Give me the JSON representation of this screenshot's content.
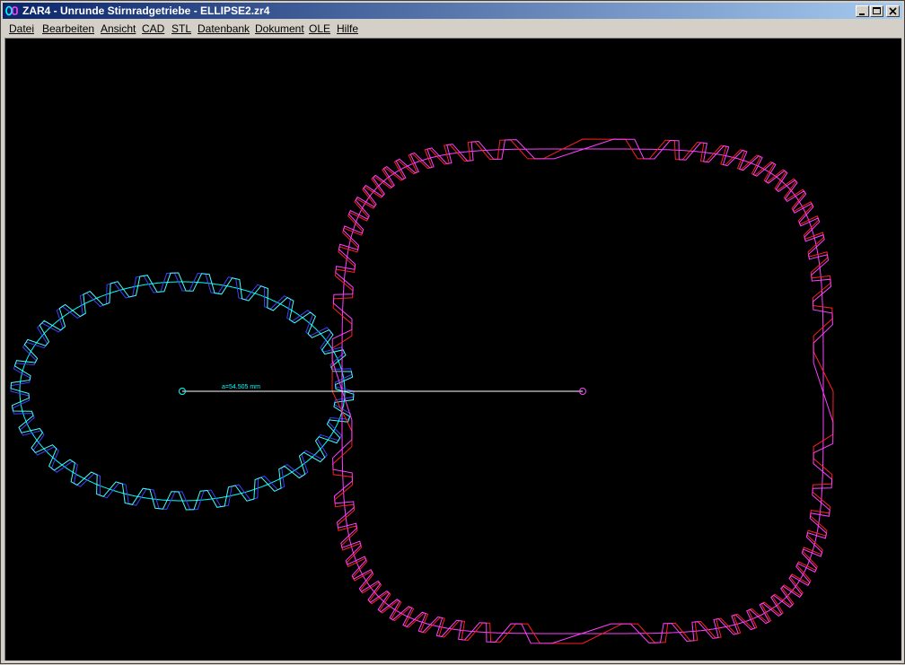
{
  "window": {
    "title": "ZAR4 - Unrunde Stirnradgetriebe  -  ELLIPSE2.zr4",
    "icon": "zar4-app-icon"
  },
  "menu": {
    "items": [
      {
        "label": "Datei"
      },
      {
        "label": "Bearbeiten"
      },
      {
        "label": "Ansicht"
      },
      {
        "label": "CAD"
      },
      {
        "label": "STL"
      },
      {
        "label": "Datenbank"
      },
      {
        "label": "Dokument"
      },
      {
        "label": "OLE"
      },
      {
        "label": "Hilfe"
      }
    ]
  },
  "drawing": {
    "distance_label": "a=54.505 mm",
    "colors": {
      "background": "#000000",
      "gear1_pitch": "#00ffff",
      "gear1_flank_a": "#4040ff",
      "gear1_flank_b": "#40ffff",
      "gear2_pitch": "#ff40ff",
      "gear2_flank_a": "#ff2020",
      "gear2_flank_b": "#ff40ff",
      "center_line": "#ffffff"
    },
    "gear1": {
      "shape": "ellipse",
      "teeth": 34
    },
    "gear2": {
      "shape": "rounded-square",
      "teeth": 64
    }
  }
}
